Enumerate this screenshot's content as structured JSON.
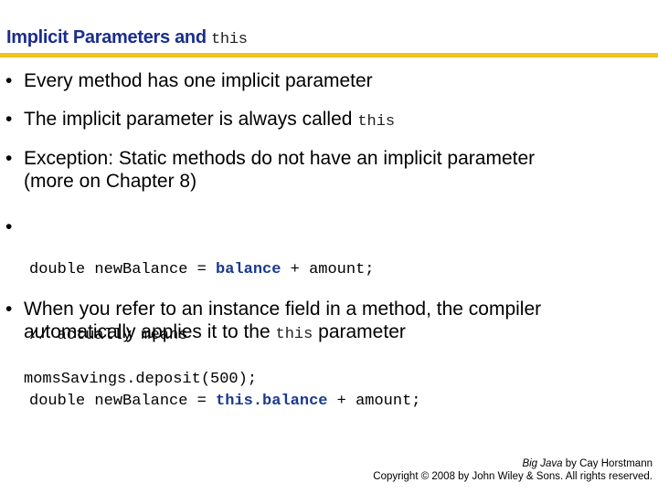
{
  "header": {
    "title_text": "Implicit Parameters and",
    "title_code": "this",
    "accent_color": "#1a2d8f",
    "rule_color": "#f2c21b"
  },
  "bullets": [
    {
      "text": "Every method has one implicit parameter"
    },
    {
      "text": "The implicit  parameter is always called",
      "code": "this"
    },
    {
      "line1": "Exception: Static methods do not have an implicit  parameter",
      "line2": "(more on Chapter 8)"
    },
    {
      "code_lines": [
        {
          "pre": "double newBalance = ",
          "kw": "balance",
          "post": " + amount;"
        },
        {
          "pre": "// actually means",
          "kw": "",
          "post": ""
        },
        {
          "pre": "double newBalance = ",
          "kw": "this.balance",
          "post": " + amount;"
        }
      ]
    },
    {
      "line1": "When you refer to an instance field in a method, the compiler",
      "line2_pre": "automatically applies it to the",
      "line2_code": "this",
      "line2_post": "parameter"
    }
  ],
  "example_code": "momsSavings.deposit(500);",
  "bullet_glyph": "•",
  "footer": {
    "book": "Big Java",
    "author": "by Cay Horstmann",
    "copyright": "Copyright © 2008 by John Wiley & Sons.  All rights reserved."
  }
}
